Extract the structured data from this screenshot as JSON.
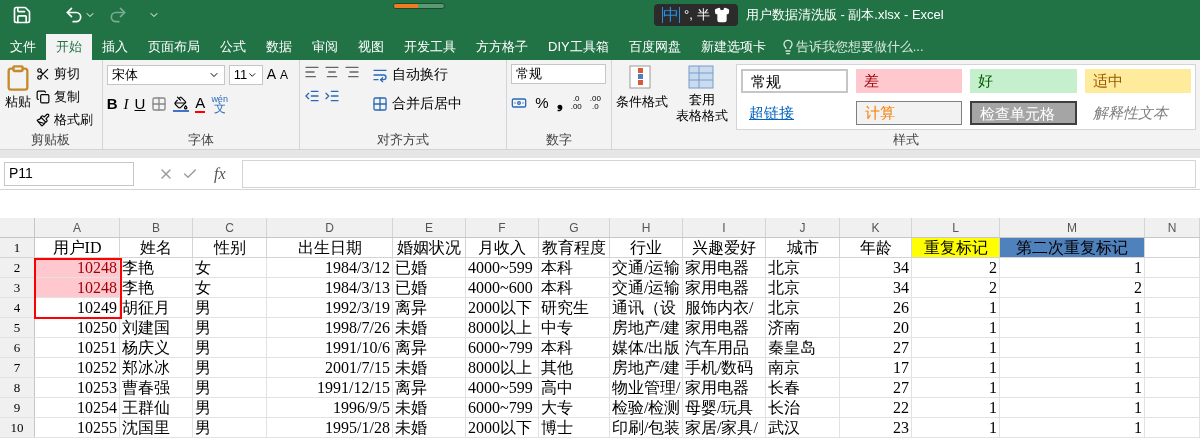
{
  "title_bar": {
    "ime": {
      "mode": "中",
      "punct": "°,",
      "width": "半"
    },
    "title": "用户数据清洗版 - 副本.xlsx - Excel"
  },
  "tabs": [
    {
      "label": "文件",
      "selected": false
    },
    {
      "label": "开始",
      "selected": true
    },
    {
      "label": "插入",
      "selected": false
    },
    {
      "label": "页面布局",
      "selected": false
    },
    {
      "label": "公式",
      "selected": false
    },
    {
      "label": "数据",
      "selected": false
    },
    {
      "label": "审阅",
      "selected": false
    },
    {
      "label": "视图",
      "selected": false
    },
    {
      "label": "开发工具",
      "selected": false
    },
    {
      "label": "方方格子",
      "selected": false
    },
    {
      "label": "DIY工具箱",
      "selected": false
    },
    {
      "label": "百度网盘",
      "selected": false
    },
    {
      "label": "新建选项卡",
      "selected": false
    }
  ],
  "tell_me": "告诉我您想要做什么...",
  "ribbon": {
    "clipboard": {
      "paste": "粘贴",
      "cut": "剪切",
      "copy": "复制",
      "format_painter": "格式刷",
      "label": "剪贴板"
    },
    "font": {
      "font_name": "宋体",
      "font_size": "11",
      "grow": "A",
      "shrink": "A",
      "bold": "B",
      "italic": "I",
      "underline": "U",
      "font_color": "A",
      "phonetic_top": "wén",
      "phonetic_bottom": "文",
      "label": "字体"
    },
    "alignment": {
      "wrap": "自动换行",
      "merge": "合并后居中",
      "label": "对齐方式"
    },
    "number": {
      "format": "常规",
      "percent": "%",
      "comma": "❟",
      "increase_decimal": [
        ".0",
        ".00"
      ],
      "decrease_decimal": [
        ".00",
        ".0"
      ],
      "label": "数字"
    },
    "styles": {
      "conditional": "条件格式",
      "table_top": "套用",
      "table_bottom": "表格格式",
      "label": "样式",
      "cells": [
        {
          "label": "常规",
          "kind": "normal"
        },
        {
          "label": "差",
          "kind": "bad"
        },
        {
          "label": "好",
          "kind": "good"
        },
        {
          "label": "适中",
          "kind": "neutral"
        },
        {
          "label": "超链接",
          "kind": "link"
        },
        {
          "label": "计算",
          "kind": "calc"
        },
        {
          "label": "检查单元格",
          "kind": "check"
        },
        {
          "label": "解释性文本",
          "kind": "explain"
        }
      ]
    }
  },
  "formula_bar": {
    "name_box": "P11",
    "fx": "fx"
  },
  "sheet": {
    "columns": [
      {
        "letter": "A",
        "kind": "number"
      },
      {
        "letter": "B",
        "kind": "text"
      },
      {
        "letter": "C",
        "kind": "text"
      },
      {
        "letter": "D",
        "kind": "number"
      },
      {
        "letter": "E",
        "kind": "text"
      },
      {
        "letter": "F",
        "kind": "text"
      },
      {
        "letter": "G",
        "kind": "text"
      },
      {
        "letter": "H",
        "kind": "text"
      },
      {
        "letter": "I",
        "kind": "text"
      },
      {
        "letter": "J",
        "kind": "text"
      },
      {
        "letter": "K",
        "kind": "number"
      },
      {
        "letter": "L",
        "kind": "number"
      },
      {
        "letter": "M",
        "kind": "number"
      },
      {
        "letter": "N",
        "kind": "text"
      }
    ],
    "header_row": {
      "number": "1",
      "cells": [
        {
          "text": "用户ID"
        },
        {
          "text": "姓名"
        },
        {
          "text": "性别"
        },
        {
          "text": "出生日期"
        },
        {
          "text": "婚姻状况"
        },
        {
          "text": "月收入"
        },
        {
          "text": "教育程度"
        },
        {
          "text": "行业"
        },
        {
          "text": "兴趣爱好"
        },
        {
          "text": "城市"
        },
        {
          "text": "年龄"
        },
        {
          "text": "重复标记",
          "color": "#ffff00"
        },
        {
          "text": "第二次重复标记",
          "color": "#4f81bd"
        }
      ]
    },
    "rows": [
      {
        "number": "2",
        "duplicate": true,
        "cells": [
          "10248",
          "李艳",
          "女",
          "1984/3/12",
          "已婚",
          "4000~599",
          "本科",
          "交通/运输",
          "家用电器",
          "北京",
          "34",
          "2",
          "1"
        ]
      },
      {
        "number": "3",
        "duplicate": true,
        "cells": [
          "10248",
          "李艳",
          "女",
          "1984/3/13",
          "已婚",
          "4000~600",
          "本科",
          "交通/运输",
          "家用电器",
          "北京",
          "34",
          "2",
          "2"
        ]
      },
      {
        "number": "4",
        "duplicate": false,
        "cells": [
          "10249",
          "胡征月",
          "男",
          "1992/3/19",
          "离异",
          "2000以下",
          "研究生",
          "通讯（设",
          "服饰内衣/",
          "北京",
          "26",
          "1",
          "1"
        ]
      },
      {
        "number": "5",
        "duplicate": false,
        "cells": [
          "10250",
          "刘建国",
          "男",
          "1998/7/26",
          "未婚",
          "8000以上",
          "中专",
          "房地产/建",
          "家用电器",
          "济南",
          "20",
          "1",
          "1"
        ]
      },
      {
        "number": "6",
        "duplicate": false,
        "cells": [
          "10251",
          "杨庆义",
          "男",
          "1991/10/6",
          "离异",
          "6000~799",
          "本科",
          "媒体/出版",
          "汽车用品",
          "秦皇岛",
          "27",
          "1",
          "1"
        ]
      },
      {
        "number": "7",
        "duplicate": false,
        "cells": [
          "10252",
          "郑冰冰",
          "男",
          "2001/7/15",
          "未婚",
          "8000以上",
          "其他",
          "房地产/建",
          "手机/数码",
          "南京",
          "17",
          "1",
          "1"
        ]
      },
      {
        "number": "8",
        "duplicate": false,
        "cells": [
          "10253",
          "曹春强",
          "男",
          "1991/12/15",
          "离异",
          "4000~599",
          "高中",
          "物业管理/",
          "家用电器",
          "长春",
          "27",
          "1",
          "1"
        ]
      },
      {
        "number": "9",
        "duplicate": false,
        "cells": [
          "10254",
          "王群仙",
          "男",
          "1996/9/5",
          "未婚",
          "6000~799",
          "大专",
          "检验/检测",
          "母婴/玩具",
          "长治",
          "22",
          "1",
          "1"
        ]
      },
      {
        "number": "10",
        "duplicate": false,
        "cells": [
          "10255",
          "沈国里",
          "男",
          "1995/1/28",
          "未婚",
          "2000以下",
          "博士",
          "印刷/包装",
          "家居/家具/",
          "武汉",
          "23",
          "1",
          "1"
        ]
      }
    ]
  }
}
